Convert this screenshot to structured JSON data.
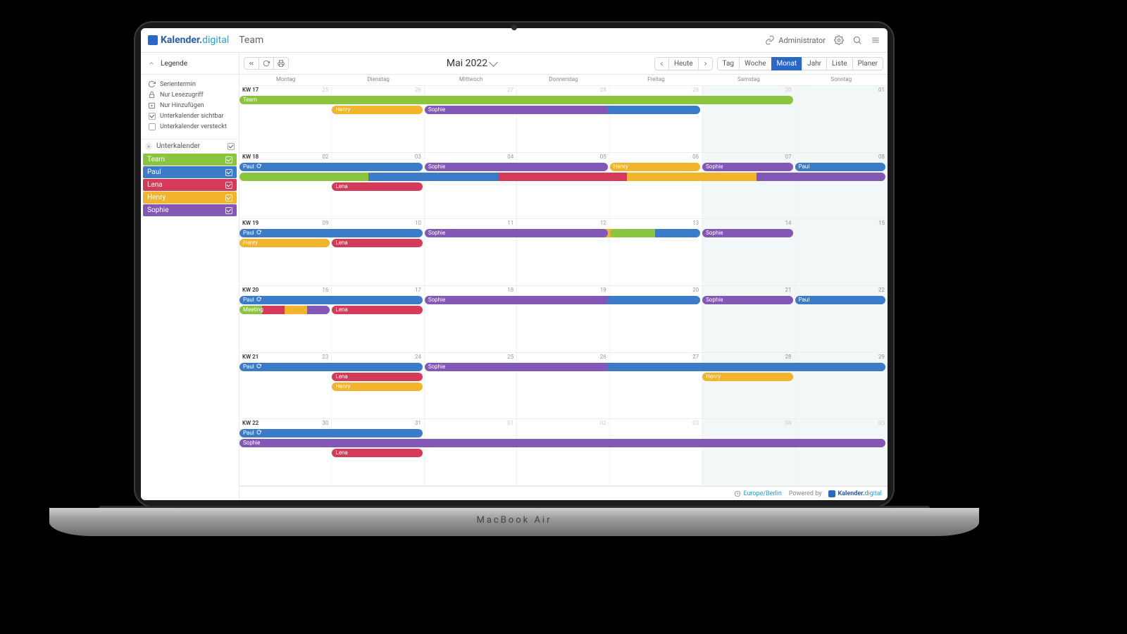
{
  "brand": {
    "a": "Kalender.",
    "b": "digital"
  },
  "team_name": "Team",
  "topbar": {
    "admin": "Administrator"
  },
  "sidebar": {
    "legend_title": "Legende",
    "legend": [
      {
        "icon": "repeat",
        "label": "Serientermin"
      },
      {
        "icon": "lock",
        "label": "Nur Lesezugriff"
      },
      {
        "icon": "add-cal",
        "label": "Nur Hinzufügen"
      },
      {
        "icon": "check-on",
        "label": "Unterkalender sichtbar"
      },
      {
        "icon": "check-off",
        "label": "Unterkalender versteckt"
      }
    ],
    "subhead": "Unterkalender",
    "calendars": [
      {
        "name": "Team",
        "color": "#8bc53f"
      },
      {
        "name": "Paul",
        "color": "#3c7bc7"
      },
      {
        "name": "Lena",
        "color": "#d63a59"
      },
      {
        "name": "Henry",
        "color": "#f2b42a"
      },
      {
        "name": "Sophie",
        "color": "#8257b5"
      }
    ]
  },
  "toolbar": {
    "today": "Heute",
    "period_title": "Mai 2022",
    "views": [
      "Tag",
      "Woche",
      "Monat",
      "Jahr",
      "Liste",
      "Planer"
    ],
    "active_view": "Monat"
  },
  "day_headers": [
    "Montag",
    "Dienstag",
    "Mittwoch",
    "Donnerstag",
    "Freitag",
    "Samstag",
    "Sonntag"
  ],
  "colors": {
    "Team": "#8bc53f",
    "Paul": "#3c7bc7",
    "Lena": "#d63a59",
    "Henry": "#f2b42a",
    "Sophie": "#8257b5"
  },
  "weeks": [
    {
      "kw": "KW 17",
      "days": [
        {
          "num": "25",
          "dim": true
        },
        {
          "num": "26",
          "dim": true
        },
        {
          "num": "27",
          "dim": true
        },
        {
          "num": "28",
          "dim": true
        },
        {
          "num": "29",
          "dim": true
        },
        {
          "num": "30",
          "dim": true,
          "we": true
        },
        {
          "num": "01",
          "we": true
        }
      ],
      "events": [
        {
          "row": 0,
          "start": 0,
          "end": 6,
          "cal": "Team",
          "label": "Team"
        },
        {
          "row": 1,
          "start": 1,
          "end": 2,
          "cal": "Henry",
          "label": "Henry"
        },
        {
          "row": 1,
          "start": 2,
          "end": 4,
          "cal": "Sophie",
          "label": "Sophie"
        },
        {
          "row": 1,
          "start": 3,
          "end": 5,
          "cal": "Paul",
          "label": "Paul",
          "underlay": true
        }
      ]
    },
    {
      "kw": "KW 18",
      "days": [
        {
          "num": "02"
        },
        {
          "num": "03"
        },
        {
          "num": "04"
        },
        {
          "num": "05"
        },
        {
          "num": "06"
        },
        {
          "num": "07",
          "we": true
        },
        {
          "num": "08",
          "we": true
        }
      ],
      "events": [
        {
          "row": 0,
          "start": 0,
          "end": 2,
          "cal": "Paul",
          "label": "Paul",
          "recurring": true
        },
        {
          "row": 0,
          "start": 2,
          "end": 4,
          "cal": "Sophie",
          "label": "Sophie"
        },
        {
          "row": 0,
          "start": 4,
          "end": 5,
          "cal": "Henry",
          "label": "Henry"
        },
        {
          "row": 0,
          "start": 5,
          "end": 6,
          "cal": "Sophie",
          "label": "Sophie"
        },
        {
          "row": 0,
          "start": 6,
          "end": 7,
          "cal": "Paul",
          "label": "Paul"
        },
        {
          "row": 1,
          "start": 0,
          "end": 7,
          "multi": [
            "Team",
            "Paul",
            "Lena",
            "Henry",
            "Sophie"
          ],
          "label": ""
        },
        {
          "row": 2,
          "start": 1,
          "end": 2,
          "cal": "Lena",
          "label": "Lena"
        }
      ]
    },
    {
      "kw": "KW 19",
      "days": [
        {
          "num": "09"
        },
        {
          "num": "10"
        },
        {
          "num": "11"
        },
        {
          "num": "12"
        },
        {
          "num": "13"
        },
        {
          "num": "14",
          "we": true
        },
        {
          "num": "15",
          "we": true
        }
      ],
      "events": [
        {
          "row": 0,
          "start": 0,
          "end": 2,
          "cal": "Paul",
          "label": "Paul",
          "recurring": true
        },
        {
          "row": 0,
          "start": 2,
          "end": 4,
          "cal": "Sophie",
          "label": "Sophie"
        },
        {
          "row": 0,
          "start": 3,
          "end": 5,
          "cal": "Henry",
          "label": "Henry",
          "underlay": true
        },
        {
          "row": 0,
          "start": 4,
          "end": 5,
          "multi": [
            "Team",
            "Paul"
          ],
          "label": ""
        },
        {
          "row": 0,
          "start": 5,
          "end": 6,
          "cal": "Sophie",
          "label": "Sophie"
        },
        {
          "row": 1,
          "start": 0,
          "end": 1,
          "cal": "Henry",
          "label": "Henry"
        },
        {
          "row": 1,
          "start": 1,
          "end": 2,
          "cal": "Lena",
          "label": "Lena"
        }
      ]
    },
    {
      "kw": "KW 20",
      "days": [
        {
          "num": "16"
        },
        {
          "num": "17"
        },
        {
          "num": "18"
        },
        {
          "num": "19"
        },
        {
          "num": "20"
        },
        {
          "num": "21",
          "we": true
        },
        {
          "num": "22",
          "we": true
        }
      ],
      "events": [
        {
          "row": 0,
          "start": 0,
          "end": 2,
          "cal": "Paul",
          "label": "Paul",
          "recurring": true
        },
        {
          "row": 0,
          "start": 2,
          "end": 4,
          "cal": "Sophie",
          "label": "Sophie"
        },
        {
          "row": 0,
          "start": 3,
          "end": 5,
          "cal": "Paul",
          "label": "Paul",
          "underlay": true
        },
        {
          "row": 0,
          "start": 5,
          "end": 6,
          "cal": "Sophie",
          "label": "Sophie"
        },
        {
          "row": 0,
          "start": 6,
          "end": 7,
          "cal": "Paul",
          "label": "Paul"
        },
        {
          "row": 1,
          "start": 0,
          "end": 1,
          "multi": [
            "Team",
            "Lena",
            "Henry",
            "Sophie"
          ],
          "label": "Meeting"
        },
        {
          "row": 1,
          "start": 1,
          "end": 2,
          "cal": "Lena",
          "label": "Lena"
        }
      ]
    },
    {
      "kw": "KW 21",
      "days": [
        {
          "num": "23"
        },
        {
          "num": "24"
        },
        {
          "num": "25"
        },
        {
          "num": "26"
        },
        {
          "num": "27"
        },
        {
          "num": "28",
          "we": true
        },
        {
          "num": "29",
          "we": true
        }
      ],
      "events": [
        {
          "row": 0,
          "start": 0,
          "end": 2,
          "cal": "Paul",
          "label": "Paul",
          "recurring": true
        },
        {
          "row": 0,
          "start": 2,
          "end": 4,
          "cal": "Sophie",
          "label": "Sophie"
        },
        {
          "row": 0,
          "start": 3,
          "end": 7,
          "cal": "Paul",
          "label": "Paul",
          "underlay": true
        },
        {
          "row": 1,
          "start": 1,
          "end": 2,
          "cal": "Lena",
          "label": "Lena"
        },
        {
          "row": 1,
          "start": 5,
          "end": 6,
          "cal": "Henry",
          "label": "Henry"
        },
        {
          "row": 2,
          "start": 1,
          "end": 2,
          "cal": "Henry",
          "label": "Henry"
        }
      ]
    },
    {
      "kw": "KW 22",
      "days": [
        {
          "num": "30"
        },
        {
          "num": "31"
        },
        {
          "num": "01",
          "dim": true
        },
        {
          "num": "02",
          "dim": true
        },
        {
          "num": "03",
          "dim": true
        },
        {
          "num": "04",
          "dim": true,
          "we": true
        },
        {
          "num": "05",
          "dim": true,
          "we": true
        }
      ],
      "events": [
        {
          "row": 0,
          "start": 0,
          "end": 2,
          "cal": "Paul",
          "label": "Paul",
          "recurring": true
        },
        {
          "row": 1,
          "start": 0,
          "end": 7,
          "cal": "Sophie",
          "label": "Sophie"
        },
        {
          "row": 2,
          "start": 1,
          "end": 2,
          "cal": "Lena",
          "label": "Lena"
        }
      ]
    }
  ],
  "footer": {
    "tz": "Europe/Berlin",
    "powered": "Powered by"
  }
}
